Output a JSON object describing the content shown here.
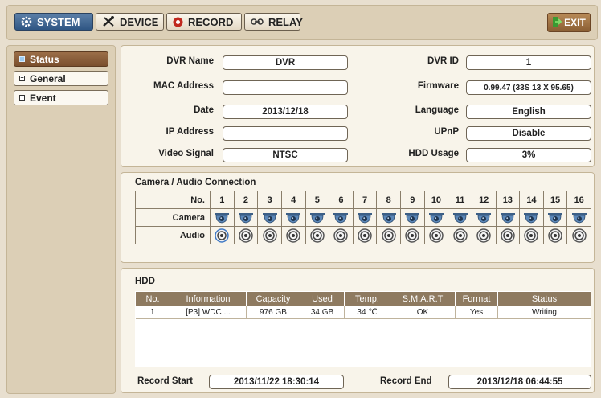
{
  "topbar": {
    "tabs": [
      {
        "label": "SYSTEM",
        "icon": "gear-icon"
      },
      {
        "label": "DEVICE",
        "icon": "tools-icon"
      },
      {
        "label": "RECORD",
        "icon": "record-icon"
      },
      {
        "label": "RELAY",
        "icon": "relay-icon"
      }
    ],
    "exit_label": "EXIT"
  },
  "sidebar": {
    "items": [
      {
        "label": "Status",
        "prefix": "■"
      },
      {
        "label": "General",
        "prefix": "+"
      },
      {
        "label": "Event",
        "prefix": ""
      }
    ]
  },
  "status": {
    "dvr_name": {
      "label": "DVR Name",
      "value": "DVR"
    },
    "mac_address": {
      "label": "MAC Address",
      "value": ""
    },
    "date": {
      "label": "Date",
      "value": "2013/12/18"
    },
    "ip_address": {
      "label": "IP Address",
      "value": ""
    },
    "video_signal": {
      "label": "Video Signal",
      "value": "NTSC"
    },
    "dvr_id": {
      "label": "DVR ID",
      "value": "1"
    },
    "firmware": {
      "label": "Firmware",
      "value": "0.99.47 (33S 13 X 95.65)"
    },
    "language": {
      "label": "Language",
      "value": "English"
    },
    "upnp": {
      "label": "UPnP",
      "value": "Disable"
    },
    "hdd_usage": {
      "label": "HDD Usage",
      "value": "3%"
    }
  },
  "camera_audio": {
    "title": "Camera / Audio Connection",
    "row_labels": {
      "no": "No.",
      "camera": "Camera",
      "audio": "Audio"
    },
    "channels": [
      "1",
      "2",
      "3",
      "4",
      "5",
      "6",
      "7",
      "8",
      "9",
      "10",
      "11",
      "12",
      "13",
      "14",
      "15",
      "16"
    ]
  },
  "hdd": {
    "title": "HDD",
    "columns": [
      "No.",
      "Information",
      "Capacity",
      "Used",
      "Temp.",
      "S.M.A.R.T",
      "Format",
      "Status"
    ],
    "rows": [
      {
        "no": "1",
        "information": "[P3] WDC ...",
        "capacity": "976 GB",
        "used": "34 GB",
        "temp": "34 ℃",
        "smart": "OK",
        "format": "Yes",
        "status": "Writing"
      }
    ],
    "record_start_label": "Record Start",
    "record_start": "2013/11/22 18:30:14",
    "record_end_label": "Record End",
    "record_end": "2013/12/18 06:44:55"
  },
  "colors": {
    "active_tab": "#2f5683",
    "active_sidebar": "#7a4f2e",
    "exit": "#8a5e33",
    "table_header": "#8e7a60"
  }
}
